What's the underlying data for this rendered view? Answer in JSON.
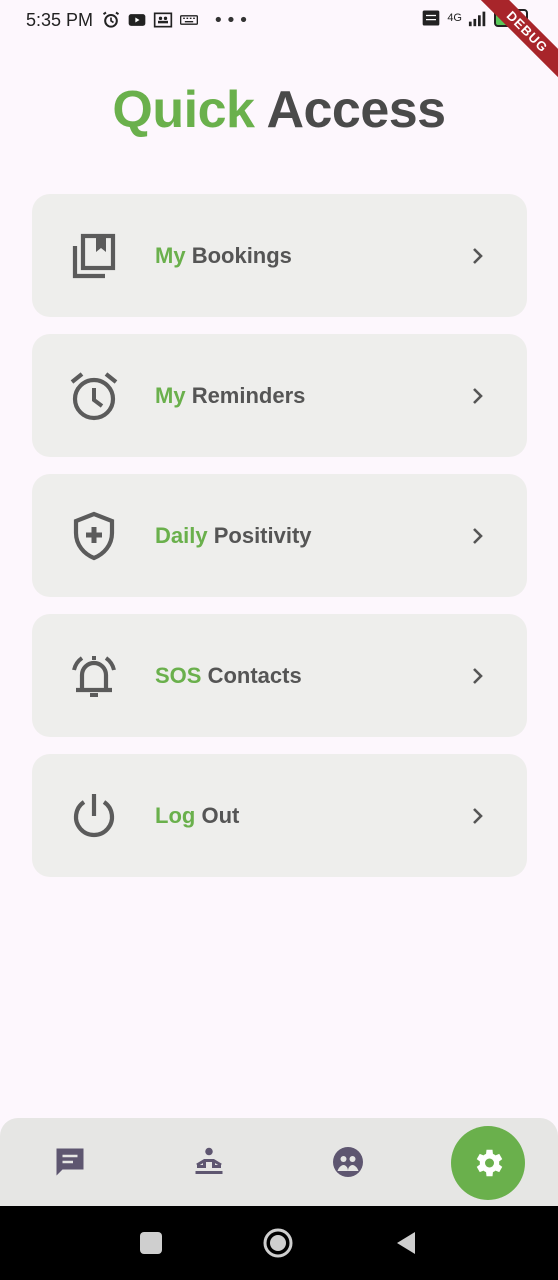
{
  "status_bar": {
    "time": "5:35 PM",
    "dots": "•••",
    "network": "4G",
    "battery": "66",
    "debug_label": "DEBUG"
  },
  "title": {
    "accent": "Quick",
    "rest": "Access"
  },
  "menu": [
    {
      "accent": "My",
      "rest": "Bookings",
      "icon": "bookings-icon"
    },
    {
      "accent": "My",
      "rest": "Reminders",
      "icon": "alarm-icon"
    },
    {
      "accent": "Daily",
      "rest": "Positivity",
      "icon": "shield-plus-icon"
    },
    {
      "accent": "SOS",
      "rest": "Contacts",
      "icon": "alarm-bell-icon"
    },
    {
      "accent": "Log",
      "rest": "Out",
      "icon": "power-icon"
    }
  ],
  "bottom_nav": [
    {
      "name": "chat",
      "icon": "chat-icon",
      "active": false
    },
    {
      "name": "meditation",
      "icon": "meditation-icon",
      "active": false
    },
    {
      "name": "community",
      "icon": "community-icon",
      "active": false
    },
    {
      "name": "settings",
      "icon": "gear-icon",
      "active": true
    }
  ],
  "colors": {
    "accent": "#6AB04C",
    "text": "#555555",
    "card": "#EEEEEC",
    "background": "#FDF7FD",
    "icon": "#5B5B5B",
    "nav_icon": "#5E5670"
  }
}
